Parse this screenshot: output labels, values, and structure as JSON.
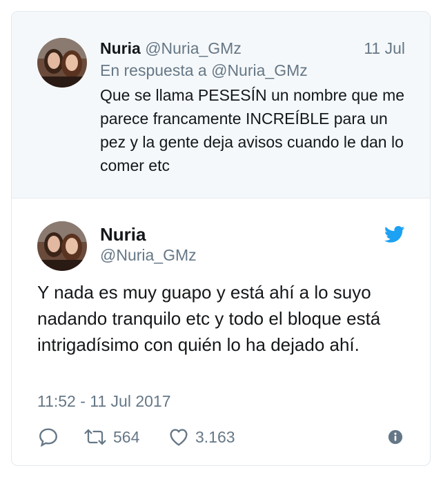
{
  "parent_tweet": {
    "name": "Nuria",
    "handle": "@Nuria_GMz",
    "date": "11 Jul",
    "reply_to": "En respuesta a @Nuria_GMz",
    "text": "Que se llama PESESÍN un nombre que me parece francamente INCREÍBLE para un pez y la gente deja avisos cuando le dan lo comer etc"
  },
  "main_tweet": {
    "name": "Nuria",
    "handle": "@Nuria_GMz",
    "text": "Y nada es muy guapo y está ahí a lo suyo nadando tranquilo etc y todo el bloque está intrigadísimo con quién lo ha dejado ahí.",
    "timestamp": "11:52 - 11 Jul 2017",
    "retweets": "564",
    "likes": "3.163"
  },
  "icons": [
    "twitter-bird-icon",
    "reply-icon",
    "retweet-icon",
    "heart-icon",
    "info-icon"
  ],
  "colors": {
    "brand": "#1da1f2",
    "muted": "#657786",
    "parent_bg": "#f5f8fa"
  }
}
